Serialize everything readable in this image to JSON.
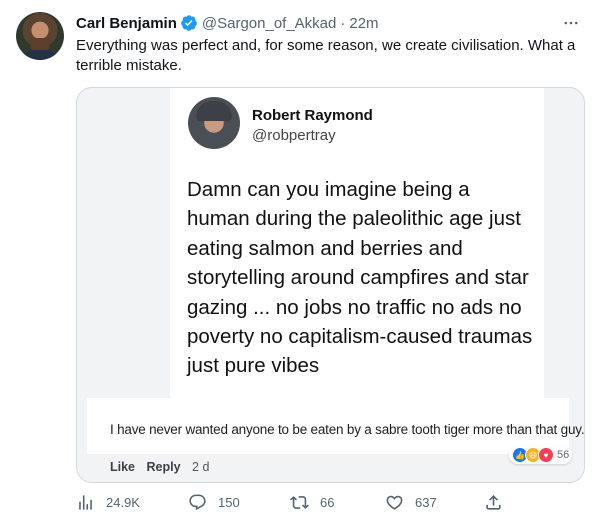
{
  "tweet": {
    "author_name": "Carl Benjamin",
    "author_handle": "@Sargon_of_Akkad",
    "separator": "·",
    "time": "22m",
    "text": "Everything was perfect and, for some reason, we create civilisation. What a terrible mistake."
  },
  "media": {
    "quoted_post": {
      "name": "Robert Raymond",
      "handle": "@robpertray",
      "body": "Damn can you imagine being a human during the paleolithic age just eating salmon and berries and storytelling around campfires and star gazing ...  no jobs no traffic no ads no poverty no capitalism-caused traumas just pure vibes"
    },
    "comment": {
      "text": "I have never wanted anyone to be eaten by a sabre tooth tiger more than that guy.",
      "like_label": "Like",
      "reply_label": "Reply",
      "age": "2 d",
      "reaction_count": "56",
      "reactions": [
        "like-icon",
        "haha-icon",
        "love-icon"
      ]
    }
  },
  "actions": {
    "views": "24.9K",
    "replies": "150",
    "retweets": "66",
    "likes": "637"
  },
  "colors": {
    "verified": "#1d9bf0",
    "secondary_text": "#536471",
    "border": "#cfd9de"
  }
}
